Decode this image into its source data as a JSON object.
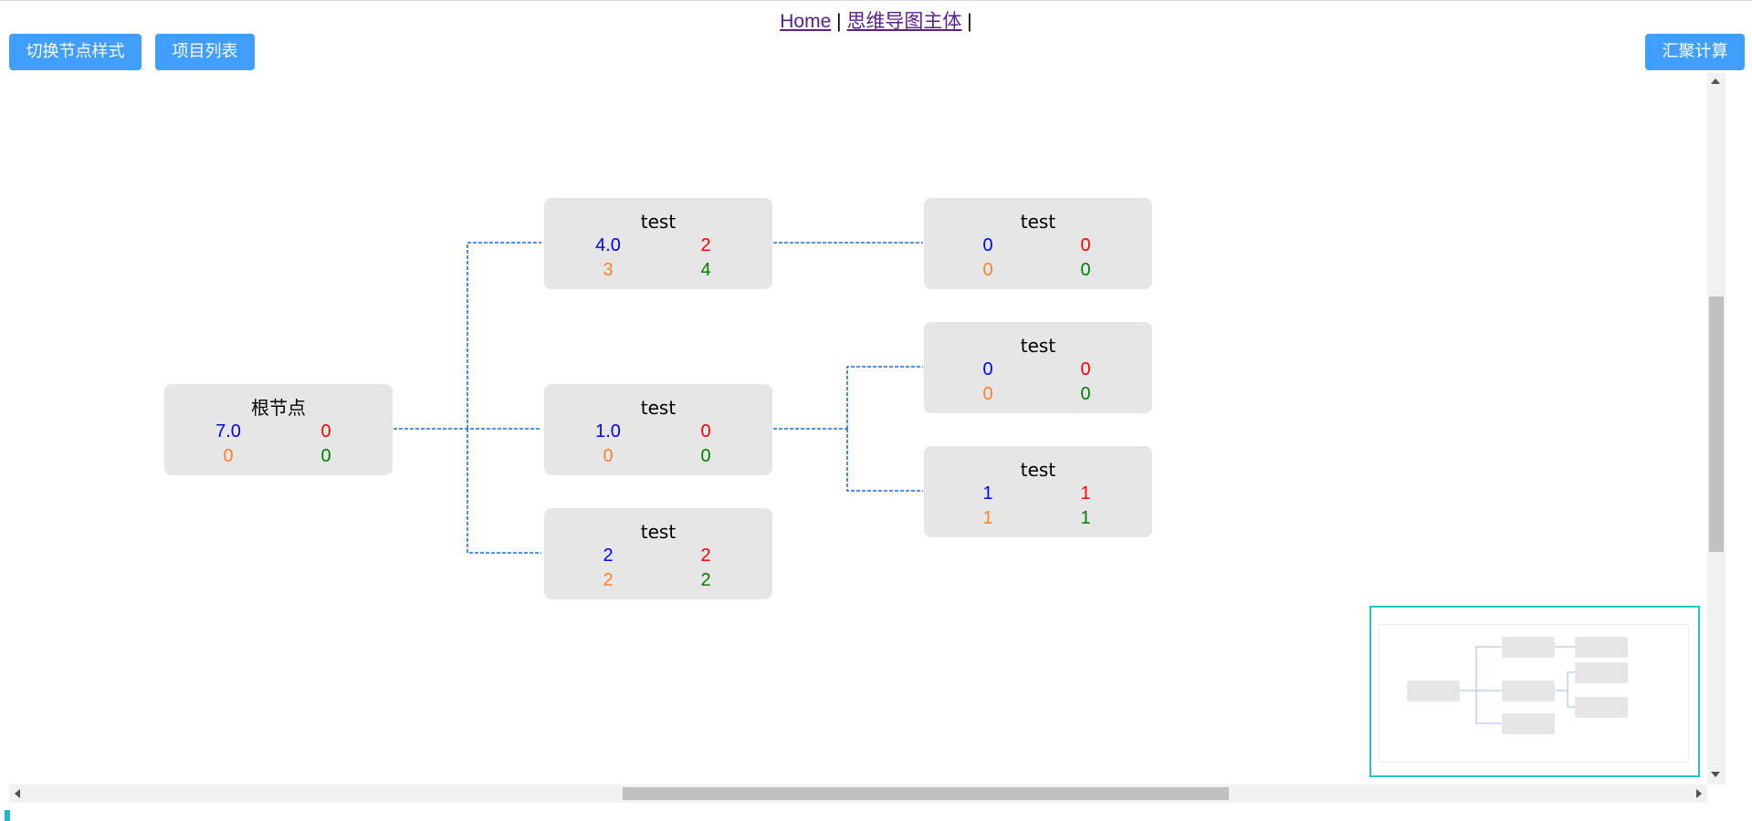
{
  "nav": {
    "home": "Home",
    "sep1": "|",
    "mindmap": "思维导图主体",
    "sep2": "|"
  },
  "toolbar": {
    "switch_style": "切换节点样式",
    "project_list": "项目列表",
    "aggregate": "汇聚计算"
  },
  "colors": {
    "button": "#409eff",
    "node_bg": "#e6e6e6",
    "link": "#1e6fd9",
    "top_left_value": "#0000ff",
    "top_right_value": "#ff0000",
    "bottom_left_value": "#ff7f27",
    "bottom_right_value": "#008000",
    "minimap_border": "#20c8c0"
  },
  "nodes": {
    "root": {
      "title": "根节点",
      "tl": "7.0",
      "tr": "0",
      "bl": "0",
      "br": "0"
    },
    "n1": {
      "title": "test",
      "tl": "4.0",
      "tr": "2",
      "bl": "3",
      "br": "4"
    },
    "n2": {
      "title": "test",
      "tl": "1.0",
      "tr": "0",
      "bl": "0",
      "br": "0"
    },
    "n3": {
      "title": "test",
      "tl": "2",
      "tr": "2",
      "bl": "2",
      "br": "2"
    },
    "n1a": {
      "title": "test",
      "tl": "0",
      "tr": "0",
      "bl": "0",
      "br": "0"
    },
    "n2a": {
      "title": "test",
      "tl": "0",
      "tr": "0",
      "bl": "0",
      "br": "0"
    },
    "n2b": {
      "title": "test",
      "tl": "1",
      "tr": "1",
      "bl": "1",
      "br": "1"
    }
  }
}
